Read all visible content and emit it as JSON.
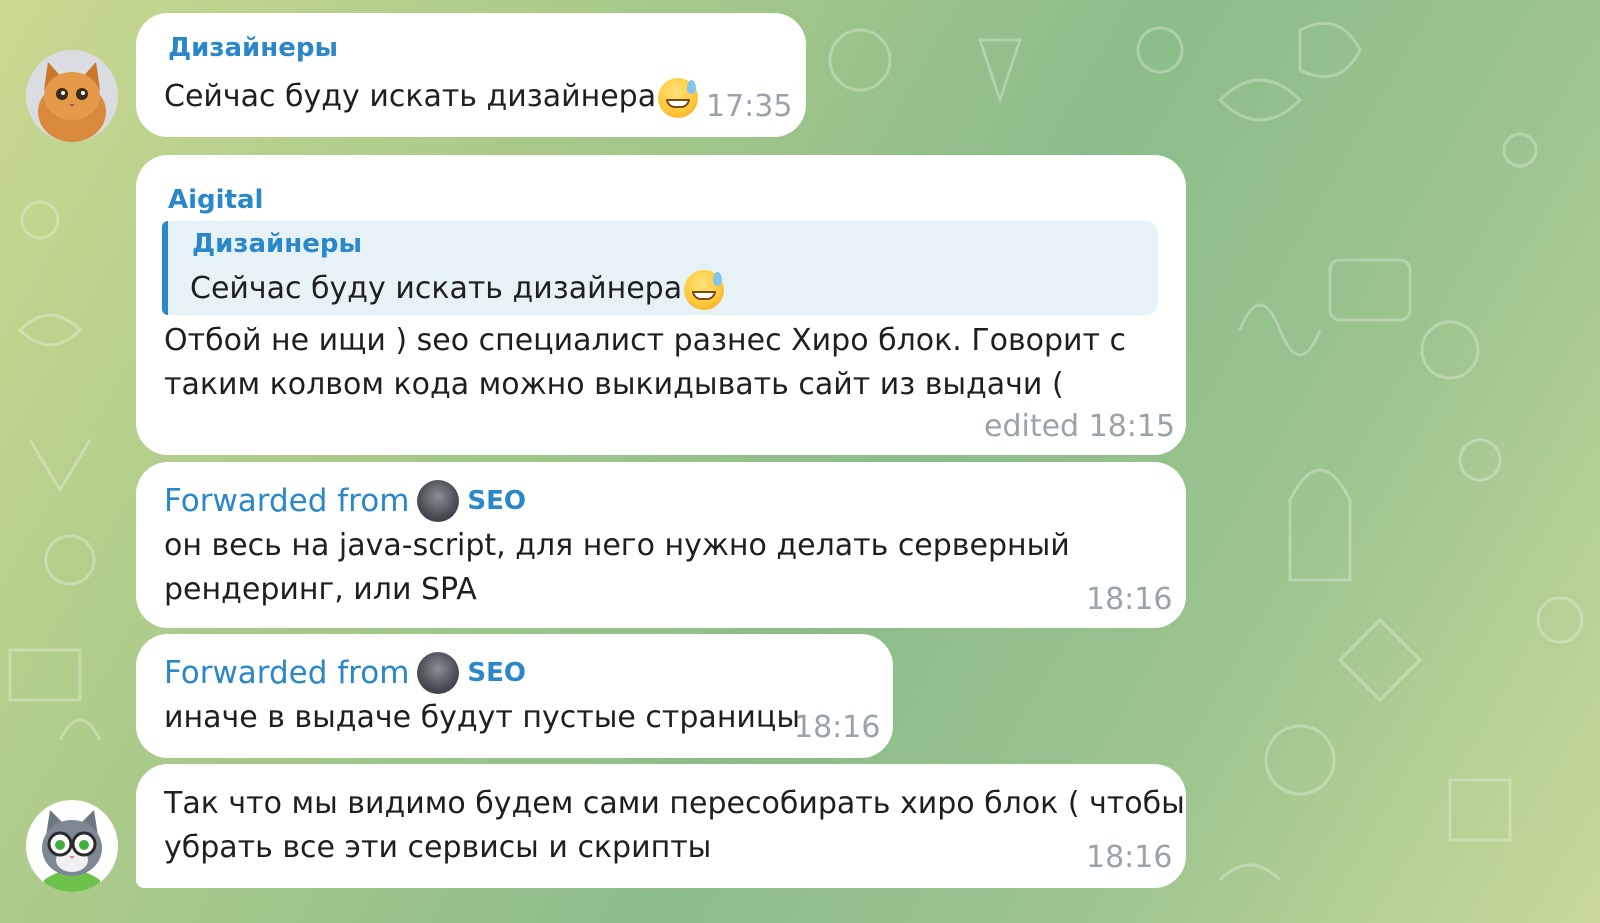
{
  "messages": [
    {
      "sender": "Дизайнеры",
      "text": "Сейчас буду искать дизайнера",
      "emoji": "sweat-smile-emoji",
      "time": "17:35"
    },
    {
      "sender": "Aigital",
      "reply": {
        "sender": "Дизайнеры",
        "text": "Сейчас буду искать дизайнера",
        "emoji": "sweat-smile-emoji"
      },
      "lines": [
        "Отбой не ищи ) seo специалист разнес Хиро блок. Говорит с",
        "таким колвом кода можно выкидывать сайт из выдачи ("
      ],
      "time": "edited 18:15"
    },
    {
      "forwarded_label": "Forwarded from",
      "forwarded_name": "SEO",
      "lines": [
        "он весь на java-script, для него нужно делать серверный",
        "рендеринг, или SPA"
      ],
      "time": "18:16"
    },
    {
      "forwarded_label": "Forwarded from",
      "forwarded_name": "SEO",
      "text": "иначе в выдаче будут пустые страницы",
      "time": "18:16"
    },
    {
      "lines": [
        "Так что мы видимо будем сами пересобирать хиро блок ( чтобы",
        "убрать все эти сервисы и скрипты"
      ],
      "time": "18:16"
    }
  ],
  "avatars": [
    "kitten-avatar",
    "cat-with-glasses-avatar"
  ],
  "colors": {
    "sender": "#2a87c9",
    "quote_bg": "#e6f2f6",
    "time": "#9aa3ab",
    "bubble": "#ffffff"
  }
}
